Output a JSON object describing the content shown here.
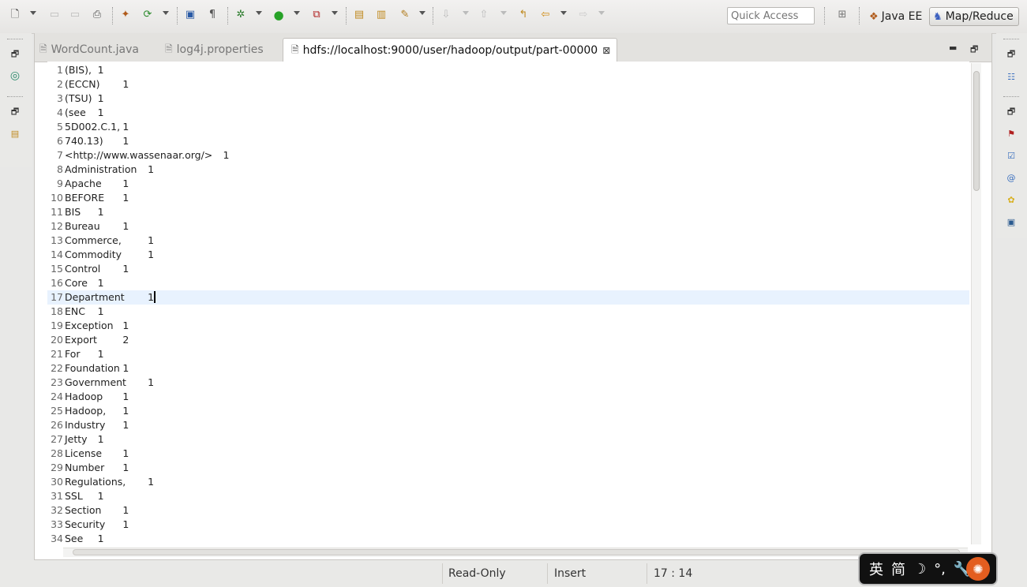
{
  "toolbar": {
    "quick_access_placeholder": "Quick Access",
    "perspectives": [
      {
        "label": "Java EE",
        "icon": "java-ee-perspective-icon"
      },
      {
        "label": "Map/Reduce",
        "icon": "elephant-icon",
        "active": true
      }
    ]
  },
  "editor": {
    "tabs": [
      {
        "label": "WordCount.java",
        "icon": "java-file-icon"
      },
      {
        "label": "log4j.properties",
        "icon": "text-file-icon"
      },
      {
        "label": "hdfs://localhost:9000/user/hadoop/output/part-00000",
        "icon": "text-file-icon",
        "active": true
      }
    ],
    "current_line": 17,
    "lines": [
      {
        "num": "1",
        "text": "(BIS),\t1"
      },
      {
        "num": "2",
        "text": "(ECCN)\t1"
      },
      {
        "num": "3",
        "text": "(TSU)\t1"
      },
      {
        "num": "4",
        "text": "(see\t1"
      },
      {
        "num": "5",
        "text": "5D002.C.1,\t1"
      },
      {
        "num": "6",
        "text": "740.13)\t1"
      },
      {
        "num": "7",
        "text": "<http://www.wassenaar.org/>\t1"
      },
      {
        "num": "8",
        "text": "Administration\t1"
      },
      {
        "num": "9",
        "text": "Apache\t1"
      },
      {
        "num": "10",
        "text": "BEFORE\t1"
      },
      {
        "num": "11",
        "text": "BIS\t1"
      },
      {
        "num": "12",
        "text": "Bureau\t1"
      },
      {
        "num": "13",
        "text": "Commerce,\t1"
      },
      {
        "num": "14",
        "text": "Commodity\t1"
      },
      {
        "num": "15",
        "text": "Control\t1"
      },
      {
        "num": "16",
        "text": "Core\t1"
      },
      {
        "num": "17",
        "text": "Department\t1"
      },
      {
        "num": "18",
        "text": "ENC\t1"
      },
      {
        "num": "19",
        "text": "Exception\t1"
      },
      {
        "num": "20",
        "text": "Export\t2"
      },
      {
        "num": "21",
        "text": "For\t1"
      },
      {
        "num": "22",
        "text": "Foundation\t1"
      },
      {
        "num": "23",
        "text": "Government\t1"
      },
      {
        "num": "24",
        "text": "Hadoop\t1"
      },
      {
        "num": "25",
        "text": "Hadoop,\t1"
      },
      {
        "num": "26",
        "text": "Industry\t1"
      },
      {
        "num": "27",
        "text": "Jetty\t1"
      },
      {
        "num": "28",
        "text": "License\t1"
      },
      {
        "num": "29",
        "text": "Number\t1"
      },
      {
        "num": "30",
        "text": "Regulations,\t1"
      },
      {
        "num": "31",
        "text": "SSL\t1"
      },
      {
        "num": "32",
        "text": "Section\t1"
      },
      {
        "num": "33",
        "text": "Security\t1"
      },
      {
        "num": "34",
        "text": "See\t1"
      }
    ]
  },
  "status": {
    "mode": "Read-Only",
    "insert": "Insert",
    "position": "17 : 14"
  },
  "ime": {
    "chars": [
      "英",
      "简",
      "☽",
      "°,",
      "🔧"
    ]
  }
}
